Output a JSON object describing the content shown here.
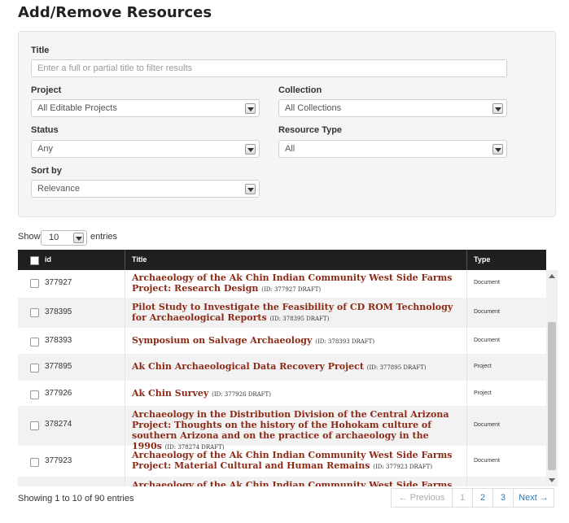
{
  "page": {
    "title": "Add/Remove Resources"
  },
  "filters": {
    "title_label": "Title",
    "title_placeholder": "Enter a full or partial title to filter results",
    "project_label": "Project",
    "project_value": "All Editable Projects",
    "collection_label": "Collection",
    "collection_value": "All Collections",
    "status_label": "Status",
    "status_value": "Any",
    "resource_type_label": "Resource Type",
    "resource_type_value": "All",
    "sort_label": "Sort by",
    "sort_value": "Relevance"
  },
  "length_menu": {
    "prefix": "Show",
    "value": "10",
    "suffix": "entries"
  },
  "table": {
    "headers": {
      "id": "id",
      "title": "Title",
      "type": "Type"
    },
    "rows": [
      {
        "id": "377927",
        "title": "Archaeology of the Ak Chin Indian Community West Side Farms Project: Research Design",
        "tag": "(ID: 377927 DRAFT)",
        "type": "Document"
      },
      {
        "id": "378395",
        "title": "Pilot Study to Investigate the Feasibility of CD ROM Technology for Archaeological Reports",
        "tag": "(ID: 378395 DRAFT)",
        "type": "Document"
      },
      {
        "id": "378393",
        "title": "Symposium on Salvage Archaeology",
        "tag": "(ID: 378393 DRAFT)",
        "type": "Document"
      },
      {
        "id": "377895",
        "title": "Ak Chin Archaeological Data Recovery Project",
        "tag": "(ID: 377895 DRAFT)",
        "type": "Project"
      },
      {
        "id": "377926",
        "title": "Ak Chin Survey",
        "tag": "(ID: 377926 DRAFT)",
        "type": "Project"
      },
      {
        "id": "378274",
        "title": "Archaeology in the Distribution Division of the Central Arizona Project: Thoughts on the history of the Hohokam culture of southern Arizona and on the practice of archaeology in the 1990s",
        "tag": "(ID: 378274 DRAFT)",
        "type": "Document"
      },
      {
        "id": "377923",
        "title": "Archaeology of the Ak Chin Indian Community West Side Farms Project: Material Cultural and Human Remains",
        "tag": "(ID: 377923 DRAFT)",
        "type": "Document"
      },
      {
        "id": "",
        "title": "Archaeology of the Ak Chin Indian Community West Side Farms",
        "tag": "",
        "type": ""
      }
    ]
  },
  "info": "Showing 1 to 10 of 90 entries",
  "pagination": {
    "previous": "← Previous",
    "pages": [
      "1",
      "2",
      "3"
    ],
    "next": "Next →"
  },
  "colors": {
    "title_link": "#8b2a16",
    "header_bg": "#1f1f1f",
    "panel_bg": "#f5f5f5"
  }
}
